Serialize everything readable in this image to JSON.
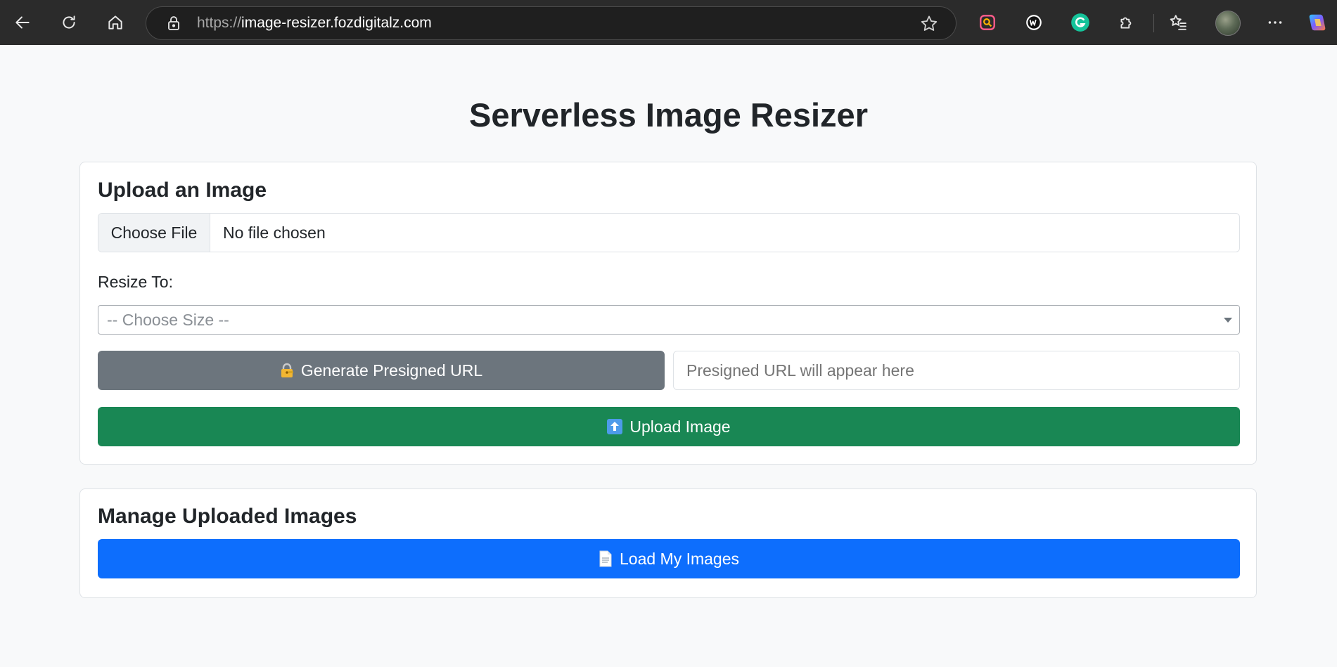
{
  "browser": {
    "url_scheme": "https://",
    "url_host": "image-resizer.fozdigitalz.com"
  },
  "page": {
    "title": "Serverless Image Resizer"
  },
  "upload_card": {
    "title": "Upload an Image",
    "choose_file_label": "Choose File",
    "file_status": "No file chosen",
    "resize_label": "Resize To:",
    "size_select_value": "-- Choose Size --",
    "generate_button_label": "Generate Presigned URL",
    "presigned_url_placeholder": "Presigned URL will appear here",
    "upload_button_label": "Upload Image"
  },
  "manage_card": {
    "title": "Manage Uploaded Images",
    "load_button_label": "Load My Images"
  },
  "icons": {
    "generate": "lock-with-key-icon",
    "upload": "up-arrow-icon",
    "load": "document-icon"
  },
  "colors": {
    "secondary": "#6c757d",
    "success": "#198754",
    "primary": "#0d6efd"
  }
}
